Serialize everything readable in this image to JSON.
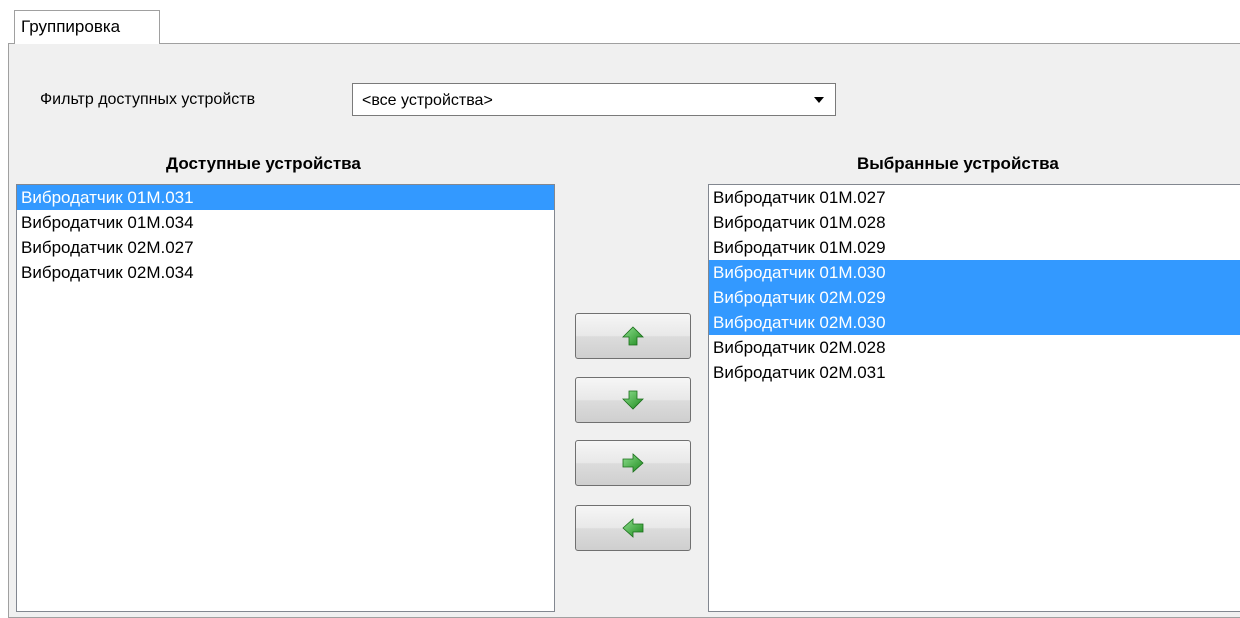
{
  "tab": {
    "label": "Группировка"
  },
  "filter": {
    "label": "Фильтр доступных устройств",
    "selected": "<все устройства>"
  },
  "available": {
    "title": "Доступные устройства",
    "items": [
      {
        "label": "Вибродатчик 01M.031",
        "selected": true
      },
      {
        "label": "Вибродатчик 01M.034",
        "selected": false
      },
      {
        "label": "Вибродатчик 02M.027",
        "selected": false
      },
      {
        "label": "Вибродатчик 02M.034",
        "selected": false
      }
    ]
  },
  "chosen": {
    "title": "Выбранные устройства",
    "items": [
      {
        "label": "Вибродатчик 01M.027",
        "selected": false
      },
      {
        "label": "Вибродатчик 01M.028",
        "selected": false
      },
      {
        "label": "Вибродатчик 01M.029",
        "selected": false
      },
      {
        "label": "Вибродатчик 01M.030",
        "selected": true
      },
      {
        "label": "Вибродатчик 02M.029",
        "selected": true
      },
      {
        "label": "Вибродатчик 02M.030",
        "selected": true
      },
      {
        "label": "Вибродатчик 02M.028",
        "selected": false
      },
      {
        "label": "Вибродатчик 02M.031",
        "selected": false
      }
    ]
  },
  "buttons": {
    "move_up": "arrow-up-icon",
    "move_down": "arrow-down-icon",
    "add_to_selected": "arrow-right-icon",
    "remove_from_selected": "arrow-left-icon"
  },
  "colors": {
    "selection": "#3399ff",
    "arrow": "#2fa82f"
  }
}
